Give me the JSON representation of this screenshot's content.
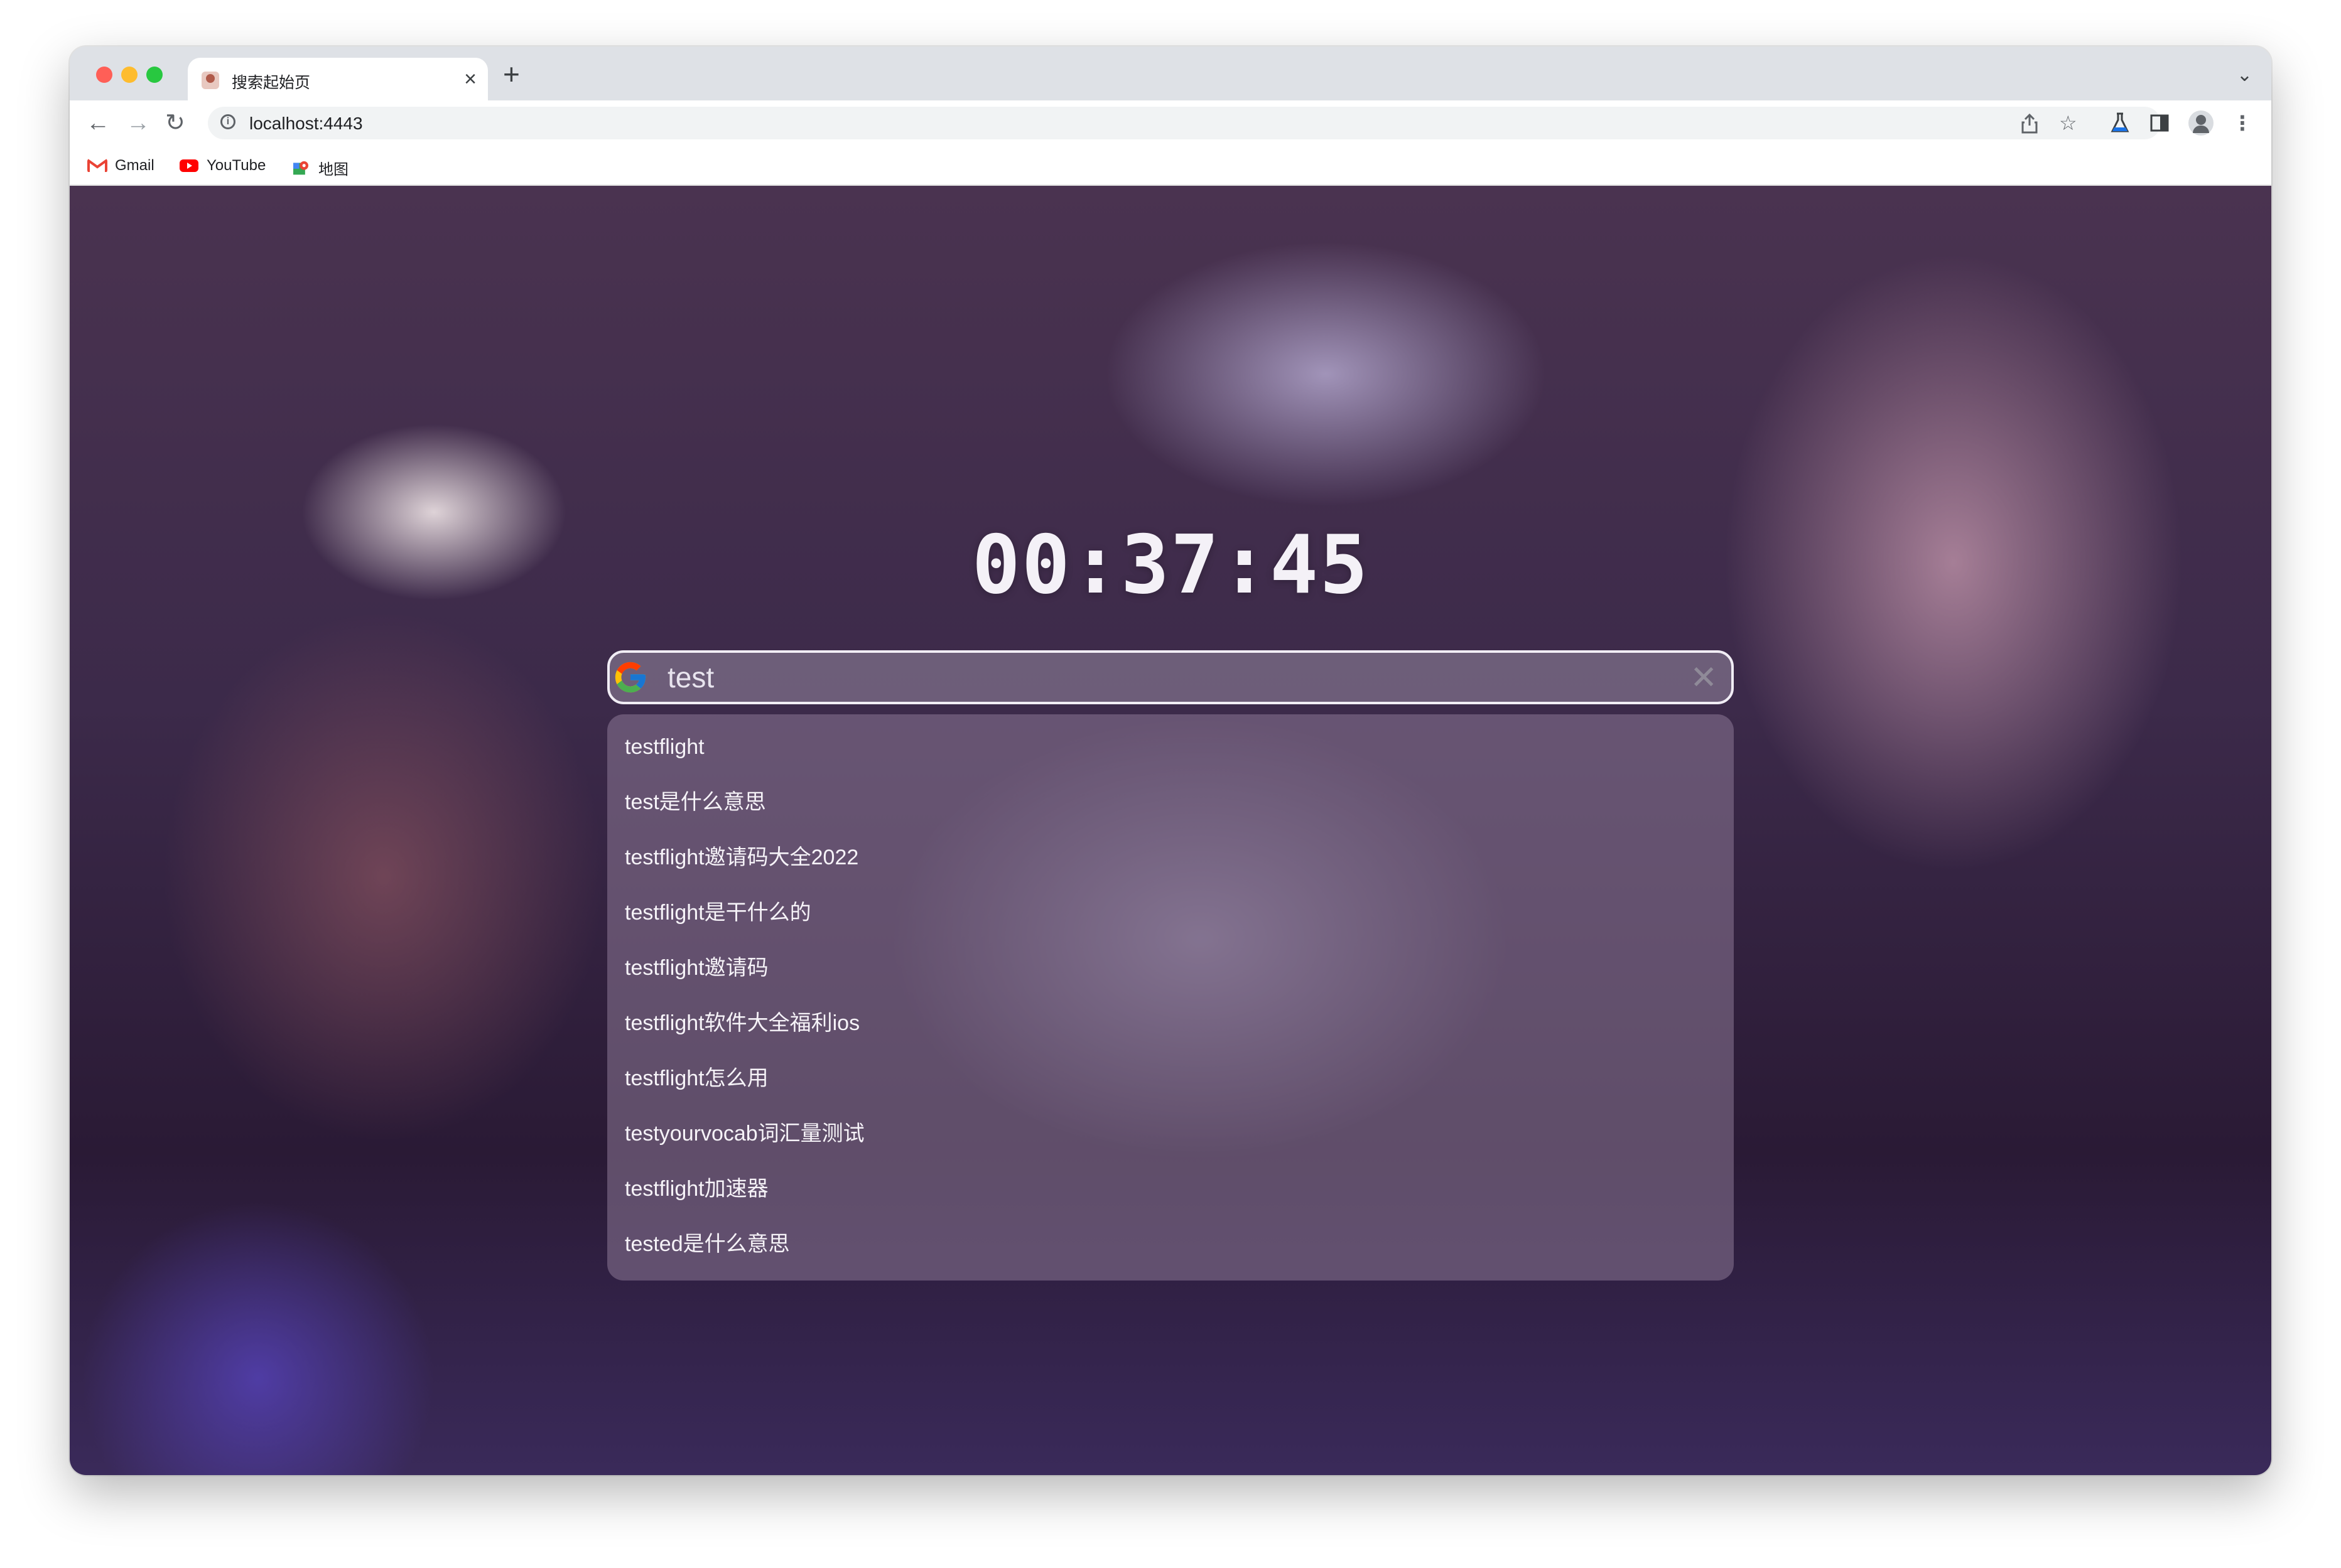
{
  "browser": {
    "tab_title": "搜索起始页",
    "tab_close": "×",
    "new_tab": "+",
    "tab_list": "⌄",
    "url": "localhost:4443",
    "bookmarks": [
      {
        "label": "Gmail",
        "icon": "gmail-icon",
        "color": "#ea4335"
      },
      {
        "label": "YouTube",
        "icon": "youtube-icon",
        "color": "#ff0000"
      },
      {
        "label": "地图",
        "icon": "maps-icon",
        "color": "#34a853"
      }
    ]
  },
  "page": {
    "clock": "00:37:45",
    "search": {
      "value": "test",
      "engine_icon": "google-icon"
    },
    "suggestions": [
      "testflight",
      "test是什么意思",
      "testflight邀请码大全2022",
      "testflight是干什么的",
      "testflight邀请码",
      "testflight软件大全福利ios",
      "testflight怎么用",
      "testyourvocab词汇量测试",
      "testflight加速器",
      "tested是什么意思"
    ]
  }
}
